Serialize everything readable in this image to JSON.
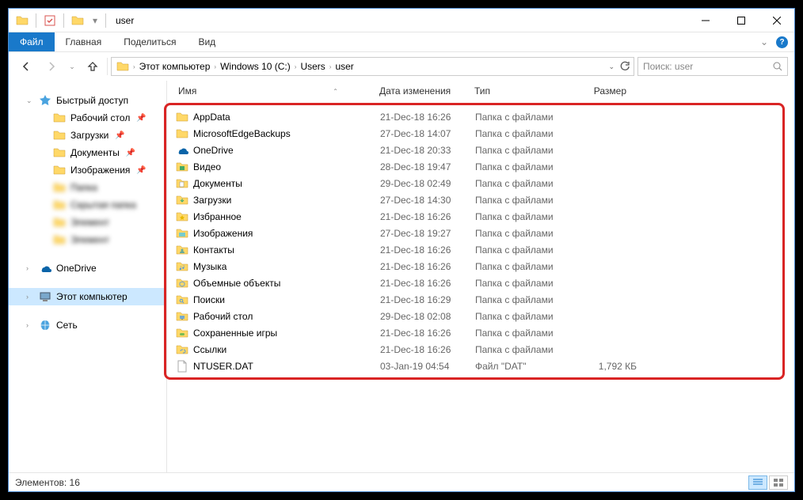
{
  "window": {
    "title": "user"
  },
  "ribbon": {
    "file": "Файл",
    "tabs": [
      "Главная",
      "Поделиться",
      "Вид"
    ]
  },
  "breadcrumb": [
    "Этот компьютер",
    "Windows 10 (C:)",
    "Users",
    "user"
  ],
  "search": {
    "placeholder": "Поиск: user"
  },
  "sidebar": {
    "quick_access": "Быстрый доступ",
    "quick_items": [
      {
        "label": "Рабочий стол",
        "pinned": true,
        "blur": false
      },
      {
        "label": "Загрузки",
        "pinned": true,
        "blur": false
      },
      {
        "label": "Документы",
        "pinned": true,
        "blur": false
      },
      {
        "label": "Изображения",
        "pinned": true,
        "blur": false
      },
      {
        "label": "Папка",
        "pinned": false,
        "blur": true
      },
      {
        "label": "Скрытая папка",
        "pinned": false,
        "blur": true
      },
      {
        "label": "Элемент",
        "pinned": false,
        "blur": true
      },
      {
        "label": "Элемент",
        "pinned": false,
        "blur": true
      }
    ],
    "onedrive": "OneDrive",
    "this_pc": "Этот компьютер",
    "network": "Сеть"
  },
  "columns": {
    "name": "Имя",
    "date": "Дата изменения",
    "type": "Тип",
    "size": "Размер"
  },
  "files": [
    {
      "icon": "folder",
      "name": "AppData",
      "date": "21-Dec-18 16:26",
      "type": "Папка с файлами",
      "size": ""
    },
    {
      "icon": "folder",
      "name": "MicrosoftEdgeBackups",
      "date": "27-Dec-18 14:07",
      "type": "Папка с файлами",
      "size": ""
    },
    {
      "icon": "onedrive",
      "name": "OneDrive",
      "date": "21-Dec-18 20:33",
      "type": "Папка с файлами",
      "size": ""
    },
    {
      "icon": "videos",
      "name": "Видео",
      "date": "28-Dec-18 19:47",
      "type": "Папка с файлами",
      "size": ""
    },
    {
      "icon": "documents",
      "name": "Документы",
      "date": "29-Dec-18 02:49",
      "type": "Папка с файлами",
      "size": ""
    },
    {
      "icon": "downloads",
      "name": "Загрузки",
      "date": "27-Dec-18 14:30",
      "type": "Папка с файлами",
      "size": ""
    },
    {
      "icon": "favorites",
      "name": "Избранное",
      "date": "21-Dec-18 16:26",
      "type": "Папка с файлами",
      "size": ""
    },
    {
      "icon": "pictures",
      "name": "Изображения",
      "date": "27-Dec-18 19:27",
      "type": "Папка с файлами",
      "size": ""
    },
    {
      "icon": "contacts",
      "name": "Контакты",
      "date": "21-Dec-18 16:26",
      "type": "Папка с файлами",
      "size": ""
    },
    {
      "icon": "music",
      "name": "Музыка",
      "date": "21-Dec-18 16:26",
      "type": "Папка с файлами",
      "size": ""
    },
    {
      "icon": "3d",
      "name": "Объемные объекты",
      "date": "21-Dec-18 16:26",
      "type": "Папка с файлами",
      "size": ""
    },
    {
      "icon": "search",
      "name": "Поиски",
      "date": "21-Dec-18 16:29",
      "type": "Папка с файлами",
      "size": ""
    },
    {
      "icon": "desktop",
      "name": "Рабочий стол",
      "date": "29-Dec-18 02:08",
      "type": "Папка с файлами",
      "size": ""
    },
    {
      "icon": "saved-games",
      "name": "Сохраненные игры",
      "date": "21-Dec-18 16:26",
      "type": "Папка с файлами",
      "size": ""
    },
    {
      "icon": "links",
      "name": "Ссылки",
      "date": "21-Dec-18 16:26",
      "type": "Папка с файлами",
      "size": ""
    },
    {
      "icon": "file",
      "name": "NTUSER.DAT",
      "date": "03-Jan-19 04:54",
      "type": "Файл \"DAT\"",
      "size": "1,792 КБ"
    }
  ],
  "status": {
    "count_label": "Элементов: 16"
  }
}
